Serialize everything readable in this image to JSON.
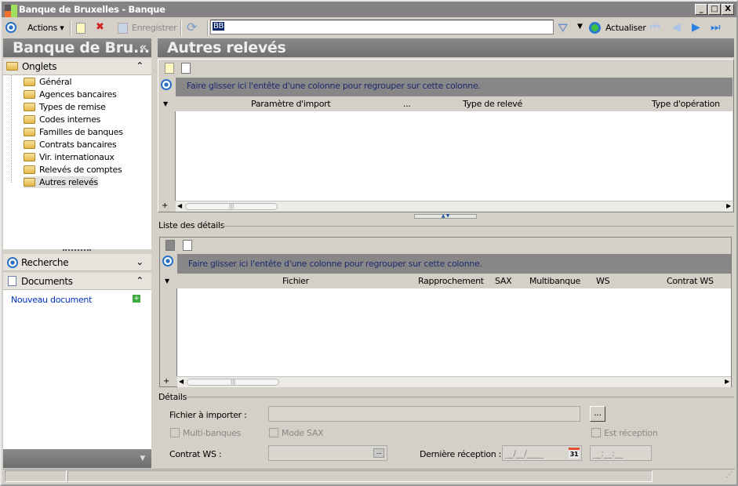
{
  "window": {
    "title": "Banque de Bruxelles -  Banque",
    "minimize": "_",
    "maximize": "□",
    "close": "X"
  },
  "toolbar": {
    "actions": "Actions",
    "save": "Enregistrer",
    "search_value": "BB",
    "refresh": "Actualiser"
  },
  "sidebar": {
    "title": "Banque de Bru...",
    "collapse": "«",
    "onglets": "Onglets",
    "items": [
      "Général",
      "Agences bancaires",
      "Types de remise",
      "Codes internes",
      "Familles de banques",
      "Contrats bancaires",
      "Vir. internationaux",
      "Relevés de comptes",
      "Autres relevés"
    ],
    "recherche": "Recherche",
    "documents": "Documents",
    "new_document": "Nouveau document"
  },
  "main": {
    "title": "Autres relevés",
    "grid1": {
      "group_hint": "Faire glisser ici l'entête d'une colonne pour regrouper sur cette colonne.",
      "columns": [
        "Paramètre d'import",
        "...",
        "Type de relevé",
        "Type d'opération"
      ]
    },
    "details_list_label": "Liste des détails",
    "grid2": {
      "group_hint": "Faire glisser ici l'entête d'une colonne pour regrouper sur cette colonne.",
      "columns": [
        "Fichier",
        "Rapprochement",
        "SAX",
        "Multibanque",
        "WS",
        "Contrat WS"
      ]
    },
    "details": {
      "label": "Détails",
      "file_label": "Fichier à importer :",
      "browse": "...",
      "multi": "Multi-banques",
      "sax": "Mode SAX",
      "reception": "Est réception",
      "contract_label": "Contrat WS :",
      "last_label": "Dernière réception  :",
      "date_mask": "__/__/____",
      "time_mask": "__:__:__",
      "cal": "31"
    }
  }
}
